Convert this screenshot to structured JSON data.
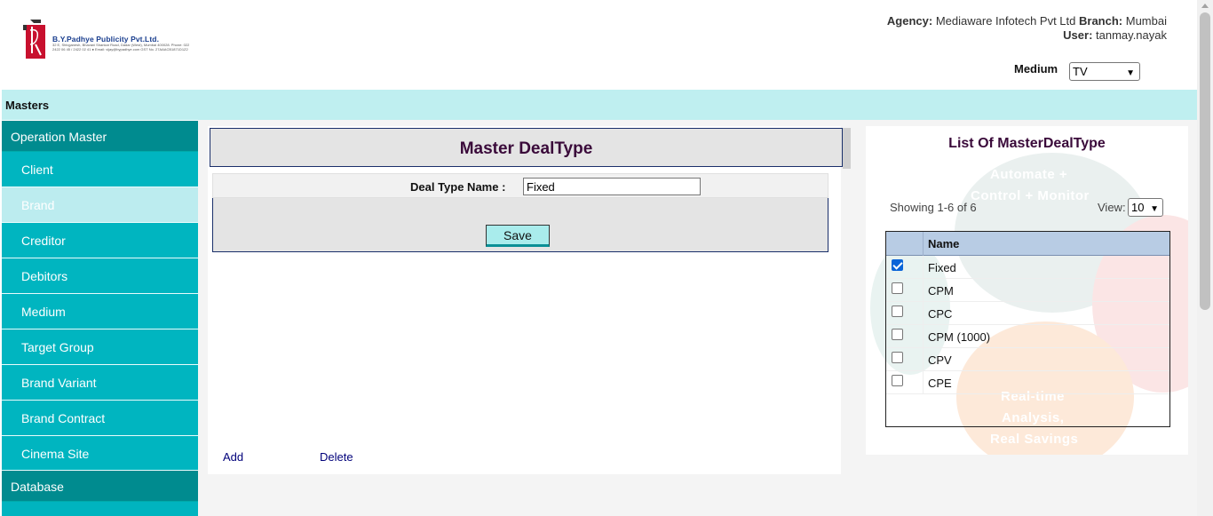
{
  "header": {
    "logo_name": "B.Y.Padhye Publicity Pvt.Ltd.",
    "logo_address": "32 E, Shivganesh, Bhavani Shankar Road, Dadar (West), Mumbai 400028. Phone: 022 2422 06 45 / 2422 02 41 ● Email: vijay@bypadhye.com GST No. 27AAACB1871D1Z2",
    "agency_label": "Agency:",
    "agency_value": "Mediaware Infotech Pvt Ltd",
    "branch_label": "Branch:",
    "branch_value": "Mumbai",
    "user_label": "User:",
    "user_value": "tanmay.nayak",
    "medium_label": "Medium",
    "medium_value": "TV"
  },
  "masters_bar": {
    "label": "Masters"
  },
  "sidebar": {
    "sections": [
      {
        "label": "Operation Master"
      },
      {
        "label": "Database"
      }
    ],
    "items": [
      {
        "label": "Client",
        "active": false
      },
      {
        "label": "Brand",
        "active": true
      },
      {
        "label": "Creditor",
        "active": false
      },
      {
        "label": "Debitors",
        "active": false
      },
      {
        "label": "Medium",
        "active": false
      },
      {
        "label": "Target Group",
        "active": false
      },
      {
        "label": "Brand Variant",
        "active": false
      },
      {
        "label": "Brand Contract",
        "active": false
      },
      {
        "label": "Cinema Site",
        "active": false
      }
    ]
  },
  "form": {
    "title": "Master DealType",
    "deal_type_label": "Deal Type Name :",
    "deal_type_value": "Fixed",
    "save_label": "Save",
    "add_label": "Add",
    "delete_label": "Delete"
  },
  "list": {
    "title": "List Of MasterDealType",
    "showing": "Showing 1-6 of 6",
    "view_label": "View:",
    "view_value": "10",
    "column_name": "Name",
    "rows": [
      {
        "name": "Fixed",
        "checked": true
      },
      {
        "name": "CPM",
        "checked": false
      },
      {
        "name": "CPC",
        "checked": false
      },
      {
        "name": "CPM (1000)",
        "checked": false
      },
      {
        "name": "CPV",
        "checked": false
      },
      {
        "name": "CPE",
        "checked": false
      }
    ],
    "watermark": {
      "line1": "Automate +",
      "line2": "Control + Monitor",
      "line3": "Real-time",
      "line4": "Analysis,",
      "line5": "Real Savings"
    }
  },
  "colors": {
    "sidebar": "#00b4bf",
    "sidebar_section": "#008b8f",
    "masters_bar": "#bfeff0",
    "title_text": "#3a0a3a"
  }
}
